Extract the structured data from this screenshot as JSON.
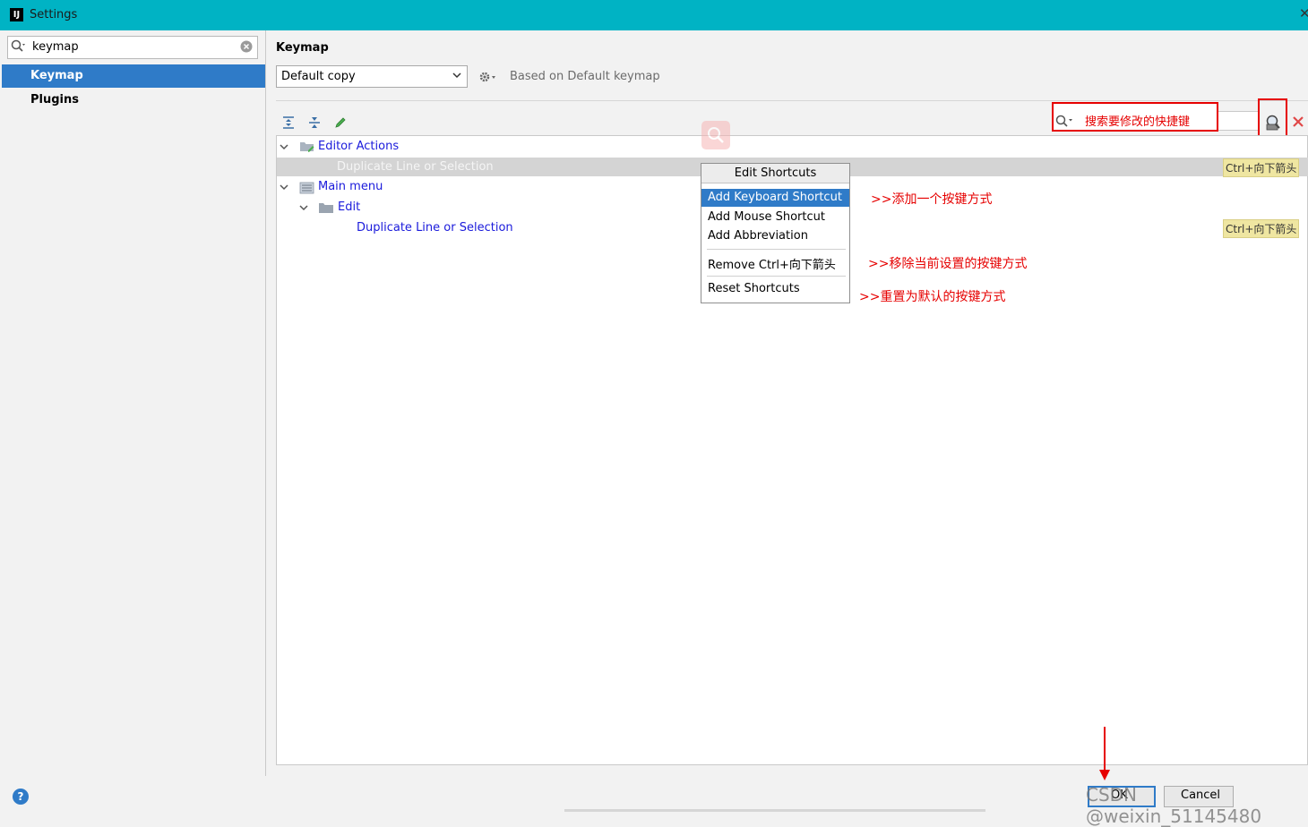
{
  "window": {
    "title": "Settings",
    "logo": "IJ"
  },
  "sidebar": {
    "search_value": "keymap",
    "items": [
      {
        "label": "Keymap",
        "selected": true
      },
      {
        "label": "Plugins",
        "selected": false
      }
    ]
  },
  "main": {
    "heading": "Keymap",
    "keymap_select": "Default copy",
    "based_on": "Based on Default keymap",
    "action_search_hint": "搜索要修改的快捷键"
  },
  "tree": {
    "editor_actions": "Editor Actions",
    "dup_selected": "Duplicate Line or Selection",
    "main_menu": "Main menu",
    "edit": "Edit",
    "dup": "Duplicate Line or Selection",
    "shortcut_1": "Ctrl+向下箭头",
    "shortcut_2": "Ctrl+向下箭头"
  },
  "popup": {
    "title": "Edit Shortcuts",
    "add_keyboard": "Add Keyboard Shortcut",
    "add_mouse": "Add Mouse Shortcut",
    "add_abbrev": "Add Abbreviation",
    "remove": "Remove Ctrl+向下箭头",
    "reset": "Reset Shortcuts"
  },
  "annotations": {
    "add": ">>添加一个按键方式",
    "remove": ">>移除当前设置的按键方式",
    "reset": ">>重置为默认的按键方式"
  },
  "footer": {
    "help": "?",
    "ok": "OK",
    "cancel": "Cancel",
    "watermark": "CSDN @weixin_51145480"
  },
  "colors": {
    "titlebar": "#00b3c4",
    "selection": "#2f7bc8",
    "annotation": "#e60000",
    "tree_link": "#1a1adb",
    "shortcut_badge": "#efe6a1"
  }
}
